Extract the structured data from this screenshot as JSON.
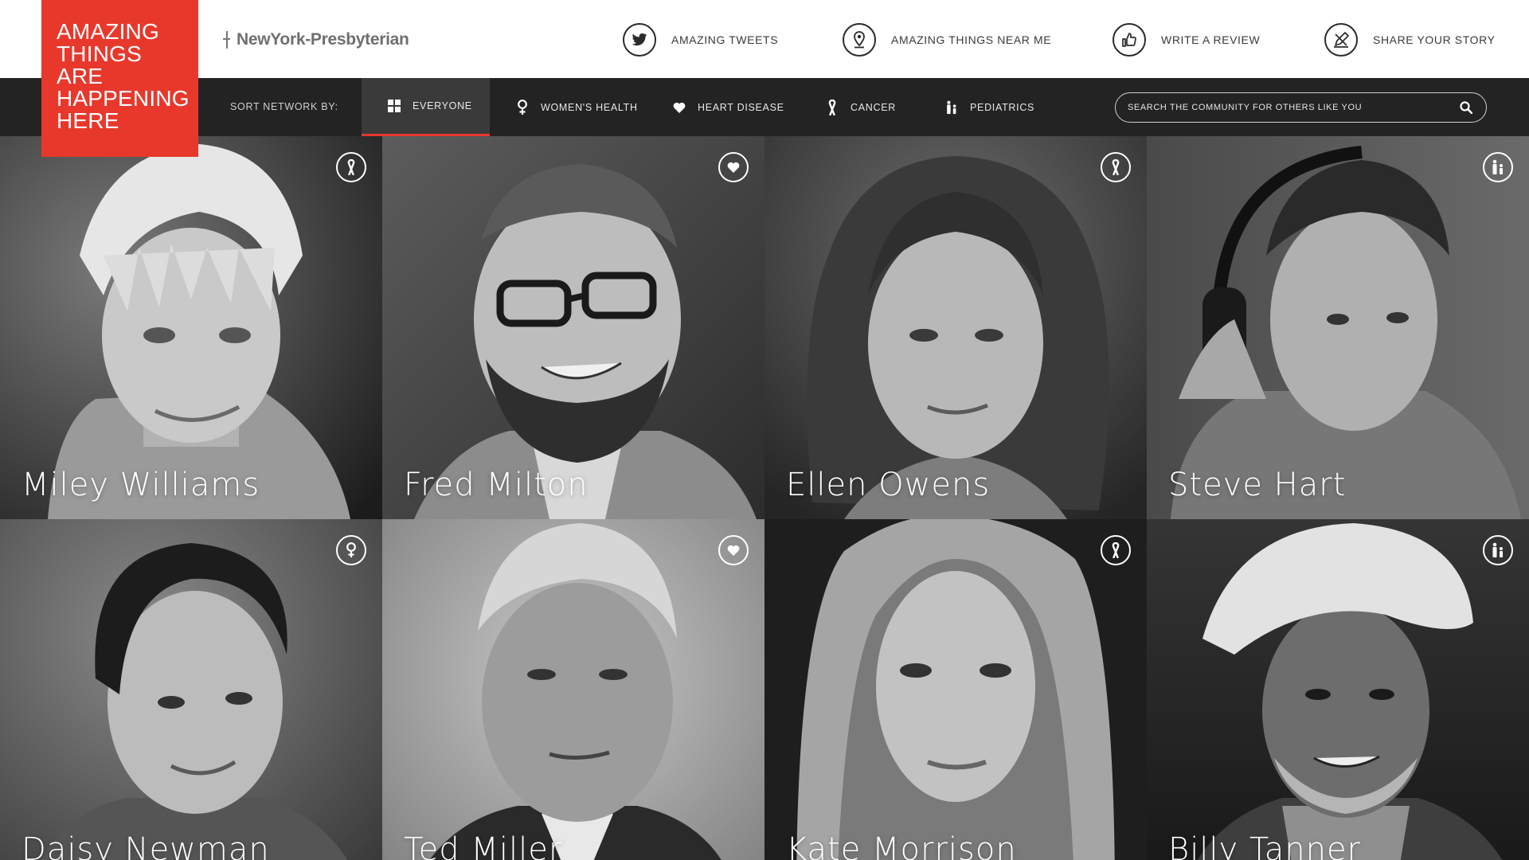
{
  "brand": {
    "tagline_lines": [
      "AMAZING",
      "THINGS",
      "ARE",
      "HAPPENING",
      "HERE"
    ],
    "accent_color": "#e8382c",
    "hospital_name": "NewYork-Presbyterian"
  },
  "top_nav": [
    {
      "label": "AMAZING TWEETS",
      "icon": "twitter-icon"
    },
    {
      "label": "AMAZING THINGS NEAR ME",
      "icon": "location-pin-icon"
    },
    {
      "label": "WRITE A REVIEW",
      "icon": "thumbs-up-icon"
    },
    {
      "label": "SHARE YOUR STORY",
      "icon": "pen-icon"
    }
  ],
  "filter_bar": {
    "sort_label": "SORT NETWORK BY:",
    "tabs": [
      {
        "label": "EVERYONE",
        "icon": "grid-icon",
        "active": true
      },
      {
        "label": "WOMEN'S HEALTH",
        "icon": "female-symbol-icon",
        "active": false
      },
      {
        "label": "HEART DISEASE",
        "icon": "heart-icon",
        "active": false
      },
      {
        "label": "CANCER",
        "icon": "awareness-ribbon-icon",
        "active": false
      },
      {
        "label": "PEDIATRICS",
        "icon": "family-icon",
        "active": false
      }
    ],
    "search_placeholder": "SEARCH THE COMMUNITY FOR OTHERS LIKE YOU"
  },
  "people": [
    {
      "name": "Miley Williams",
      "category_icon": "awareness-ribbon-icon"
    },
    {
      "name": "Fred Milton",
      "category_icon": "heart-icon"
    },
    {
      "name": "Ellen Owens",
      "category_icon": "awareness-ribbon-icon"
    },
    {
      "name": "Steve Hart",
      "category_icon": "family-icon"
    },
    {
      "name": "Daisy Newman",
      "category_icon": "female-symbol-icon"
    },
    {
      "name": "Ted Miller",
      "category_icon": "heart-icon"
    },
    {
      "name": "Kate Morrison",
      "category_icon": "awareness-ribbon-icon"
    },
    {
      "name": "Billy Tanner",
      "category_icon": "family-icon"
    }
  ]
}
